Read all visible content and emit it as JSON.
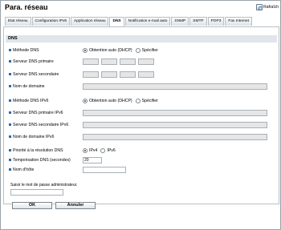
{
  "header": {
    "title": "Para. réseau",
    "refresh_label": "Rafraîch"
  },
  "tabs": [
    {
      "label": "Etat réseau"
    },
    {
      "label": "Configuration IPv6"
    },
    {
      "label": "Application réseau"
    },
    {
      "label": "DNS"
    },
    {
      "label": "Notification e-mail auto"
    },
    {
      "label": "SNMP"
    },
    {
      "label": "SMTP"
    },
    {
      "label": "POP3"
    },
    {
      "label": "Fax Internet"
    }
  ],
  "active_tab": "DNS",
  "section": {
    "title": "DNS"
  },
  "ipv4": {
    "method_label": "Méthode DNS",
    "opt_auto": "Obtention auto (DHCP)",
    "opt_manual": "Spécifier",
    "selected": "auto",
    "primary_label": "Serveur DNS primaire",
    "secondary_label": "Serveur DNS secondaire",
    "domain_label": "Nom de domaine"
  },
  "ipv6": {
    "method_label": "Méthode DNS IPv6",
    "opt_auto": "Obtention auto (DHCP)",
    "opt_manual": "Spécifier",
    "selected": "auto",
    "primary_label": "Serveur DNS primaire IPv6",
    "secondary_label": "Serveur DNS secondaire IPv6",
    "domain_label": "Nom de domaine IPv6"
  },
  "resolution": {
    "label": "Priorité à la résolution DNS",
    "opt_ipv4": "IPv4",
    "opt_ipv6": "IPv6",
    "selected": "IPv4"
  },
  "timeout": {
    "label": "Temporisation DNS (secondes)",
    "value": "20"
  },
  "host": {
    "label": "Nom d'hôte",
    "value": ""
  },
  "admin": {
    "label": "Saisir le mot de passe administrateur.",
    "value": ""
  },
  "buttons": {
    "ok": "OK",
    "cancel": "Annuler"
  },
  "colors": {
    "section_bar": "#dfe5ea",
    "bullet": "#2a6aa8",
    "disabled_field": "#e6e6e6"
  }
}
